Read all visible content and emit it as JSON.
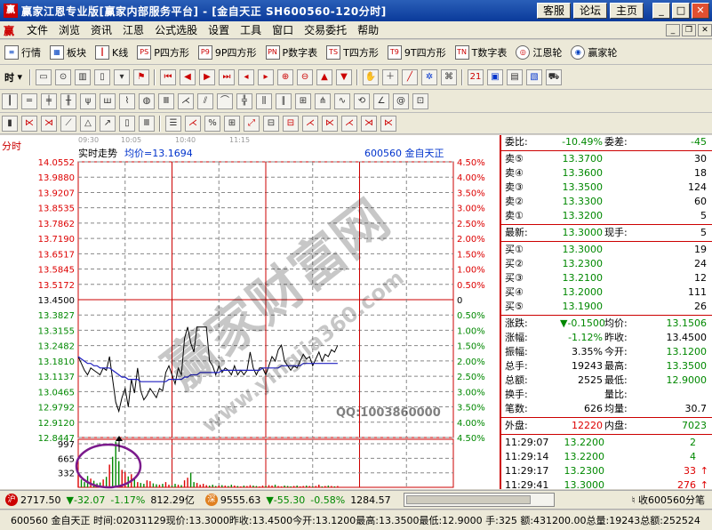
{
  "window": {
    "title": "赢家江恩专业版[赢家内部服务平台] - [金自天正  SH600560-120分时]",
    "buttons": [
      "客服",
      "论坛",
      "主页"
    ]
  },
  "menu": [
    "文件",
    "浏览",
    "资讯",
    "江恩",
    "公式选股",
    "设置",
    "工具",
    "窗口",
    "交易委托",
    "帮助"
  ],
  "toolbar1": [
    {
      "icon": "list-icon",
      "label": "行情"
    },
    {
      "icon": "grid-icon",
      "label": "板块"
    },
    {
      "icon": "candle-icon",
      "label": "K线"
    },
    {
      "icon": "p-square-icon",
      "label": "P四方形",
      "code": "PS"
    },
    {
      "icon": "p9-icon",
      "label": "9P四方形",
      "code": "P9"
    },
    {
      "icon": "pn-icon",
      "label": "P数字表",
      "code": "PN"
    },
    {
      "icon": "ts-icon",
      "label": "T四方形",
      "code": "TS"
    },
    {
      "icon": "t9-icon",
      "label": "9T四方形",
      "code": "T9"
    },
    {
      "icon": "tn-icon",
      "label": "T数字表",
      "code": "TN"
    },
    {
      "icon": "wheel-icon",
      "label": "江恩轮"
    },
    {
      "icon": "winner-wheel-icon",
      "label": "赢家轮"
    }
  ],
  "toolbar2_label": "时",
  "chart": {
    "side_label": "分时",
    "title": "实时走势",
    "avg_label": "均价=13.1694",
    "stock_label": "600560  金自天正",
    "time_ticks": [
      "09:30",
      "10:05",
      "10:40",
      "11:15"
    ],
    "watermark_qq": "QQ:1003860000"
  },
  "chart_data": {
    "type": "line",
    "title": "实时走势",
    "prev_close": 13.45,
    "y_price_ticks": [
      14.0552,
      13.988,
      13.9207,
      13.8535,
      13.7862,
      13.719,
      13.6517,
      13.5845,
      13.5172,
      13.45,
      13.3827,
      13.3155,
      13.2482,
      13.181,
      13.1137,
      13.0465,
      12.9792,
      12.912,
      12.8447
    ],
    "y_pct_ticks": [
      "4.50%",
      "4.00%",
      "3.50%",
      "3.00%",
      "2.50%",
      "2.00%",
      "1.50%",
      "1.00%",
      "0.50%",
      "0",
      "0.50%",
      "1.00%",
      "1.50%",
      "2.00%",
      "2.50%",
      "3.00%",
      "3.50%",
      "4.00%",
      "4.50%"
    ],
    "ylim": [
      12.8447,
      14.0552
    ],
    "x_ticks": [
      "09:30",
      "10:05",
      "10:40",
      "11:15"
    ],
    "minutes_total": 120,
    "series": [
      {
        "color": "#000000",
        "values": [
          13.2,
          13.17,
          13.14,
          13.12,
          13.15,
          13.14,
          13.13,
          13.12,
          13.15,
          13.14,
          13.2,
          13.1,
          13.0,
          12.96,
          13.02,
          13.06,
          12.98,
          13.1,
          13.04,
          13.15,
          13.05,
          13.01,
          13.03,
          13.06,
          13.04,
          13.02,
          13.06,
          13.05,
          13.13,
          13.16,
          13.12,
          13.08,
          13.15,
          13.12,
          13.28,
          13.33,
          13.26,
          13.22,
          13.33,
          13.33,
          13.33,
          13.33,
          13.18,
          13.16,
          13.12,
          13.16,
          13.13,
          13.15,
          13.14,
          13.12,
          13.16,
          13.12,
          13.14,
          13.12,
          13.14,
          13.22,
          13.15,
          13.12,
          13.15,
          13.15,
          13.12,
          13.16,
          13.2,
          13.18,
          13.23,
          13.25,
          13.18,
          13.16,
          13.14,
          13.16,
          13.15,
          13.18,
          13.21,
          13.19,
          13.2,
          13.16,
          13.19,
          13.22,
          13.18,
          13.21,
          13.2,
          13.23,
          13.22,
          13.25
        ]
      },
      {
        "color": "#2020c0",
        "values": [
          13.2,
          13.19,
          13.18,
          13.17,
          13.17,
          13.16,
          13.16,
          13.15,
          13.15,
          13.15,
          13.15,
          13.14,
          13.13,
          13.12,
          13.11,
          13.11,
          13.1,
          13.1,
          13.1,
          13.1,
          13.09,
          13.09,
          13.09,
          13.09,
          13.09,
          13.09,
          13.09,
          13.09,
          13.09,
          13.1,
          13.1,
          13.1,
          13.1,
          13.1,
          13.11,
          13.11,
          13.12,
          13.12,
          13.12,
          13.13,
          13.13,
          13.13,
          13.13,
          13.13,
          13.13,
          13.13,
          13.14,
          13.14,
          13.14,
          13.14,
          13.14,
          13.14,
          13.14,
          13.14,
          13.14,
          13.14,
          13.14,
          13.14,
          13.14,
          13.15,
          13.15,
          13.15,
          13.15,
          13.15,
          13.15,
          13.16,
          13.16,
          13.16,
          13.16,
          13.16,
          13.16,
          13.16,
          13.17,
          13.17,
          13.17,
          13.17,
          13.17,
          13.17,
          13.17,
          13.17,
          13.17,
          13.17,
          13.17,
          13.17
        ]
      }
    ],
    "volume_ticks": [
      997,
      665,
      332
    ],
    "volume_max": 1100,
    "volume": [
      300,
      180,
      120,
      260,
      200,
      150,
      90,
      110,
      180,
      240,
      520,
      700,
      1050,
      600,
      400,
      350,
      250,
      300,
      200,
      120,
      100,
      80,
      160,
      140,
      90,
      70,
      60,
      80,
      120,
      60,
      40,
      80,
      60,
      50,
      160,
      220,
      330,
      120,
      100,
      60,
      80,
      50,
      40,
      60,
      30,
      40,
      50,
      40,
      30,
      60,
      40,
      30,
      20,
      40,
      30,
      50,
      40,
      30,
      20,
      40,
      30,
      50,
      40,
      60,
      30,
      20,
      40,
      30,
      20,
      30,
      40,
      20,
      30,
      40,
      30,
      20,
      30,
      60,
      20,
      30,
      40,
      30,
      20,
      30
    ]
  },
  "quote": {
    "weibi_label": "委比:",
    "weibi": "-10.49%",
    "weicha_label": "委差:",
    "weicha": "-45",
    "asks": [
      {
        "label": "卖⑤",
        "price": "13.3700",
        "vol": "30"
      },
      {
        "label": "卖④",
        "price": "13.3600",
        "vol": "18"
      },
      {
        "label": "卖③",
        "price": "13.3500",
        "vol": "124"
      },
      {
        "label": "卖②",
        "price": "13.3300",
        "vol": "60"
      },
      {
        "label": "卖①",
        "price": "13.3200",
        "vol": "5"
      }
    ],
    "last_label": "最新:",
    "last": "13.3000",
    "now_label": "现手:",
    "now": "5",
    "bids": [
      {
        "label": "买①",
        "price": "13.3000",
        "vol": "19"
      },
      {
        "label": "买②",
        "price": "13.2300",
        "vol": "24"
      },
      {
        "label": "买③",
        "price": "13.2100",
        "vol": "12"
      },
      {
        "label": "买④",
        "price": "13.2000",
        "vol": "111"
      },
      {
        "label": "买⑤",
        "price": "13.1900",
        "vol": "26"
      }
    ],
    "stats": [
      {
        "l1": "涨跌:",
        "v1": "▼-0.1500",
        "c1": "green",
        "l2": "均价:",
        "v2": "13.1506",
        "c2": "green"
      },
      {
        "l1": "涨幅:",
        "v1": "-1.12%",
        "c1": "green",
        "l2": "昨收:",
        "v2": "13.4500",
        "c2": ""
      },
      {
        "l1": "振幅:",
        "v1": "3.35%",
        "c1": "",
        "l2": "今开:",
        "v2": "13.1200",
        "c2": "green"
      },
      {
        "l1": "总手:",
        "v1": "19243",
        "c1": "",
        "l2": "最高:",
        "v2": "13.3500",
        "c2": "green"
      },
      {
        "l1": "总额:",
        "v1": "2525",
        "c1": "",
        "l2": "最低:",
        "v2": "12.9000",
        "c2": "green"
      },
      {
        "l1": "换手:",
        "v1": "",
        "c1": "",
        "l2": "量比:",
        "v2": "",
        "c2": ""
      },
      {
        "l1": "笔数:",
        "v1": "626",
        "c1": "",
        "l2": "均量:",
        "v2": "30.7",
        "c2": ""
      }
    ],
    "outer_label": "外盘:",
    "outer": "12220",
    "inner_label": "内盘:",
    "inner": "7023",
    "ticks": [
      {
        "time": "11:29:07",
        "price": "13.2200",
        "vol": "2",
        "dir": ""
      },
      {
        "time": "11:29:14",
        "price": "13.2200",
        "vol": "4",
        "dir": ""
      },
      {
        "time": "11:29:17",
        "price": "13.2300",
        "vol": "33",
        "dir": "↑"
      },
      {
        "time": "11:29:41",
        "price": "13.3000",
        "vol": "276",
        "dir": "↑"
      },
      {
        "time": "11:29:53",
        "price": "13.3000",
        "vol": "5",
        "dir": ""
      }
    ]
  },
  "index_bar": {
    "sh_value": "2717.50",
    "sh_change": "▼-32.07",
    "sh_pct": "-1.17%",
    "sh_amount": "812.29亿",
    "sz_value": "9555.63",
    "sz_change": "▼-55.30",
    "sz_pct": "-0.58%",
    "sz_amount": "1284.57",
    "collect_label": "收600560分笔"
  },
  "status": "600560 金自天正 时间:02031129现价:13.3000昨收:13.4500今开:13.1200最高:13.3500最低:12.9000 手:325 额:431200.00总量:19243总额:252524"
}
